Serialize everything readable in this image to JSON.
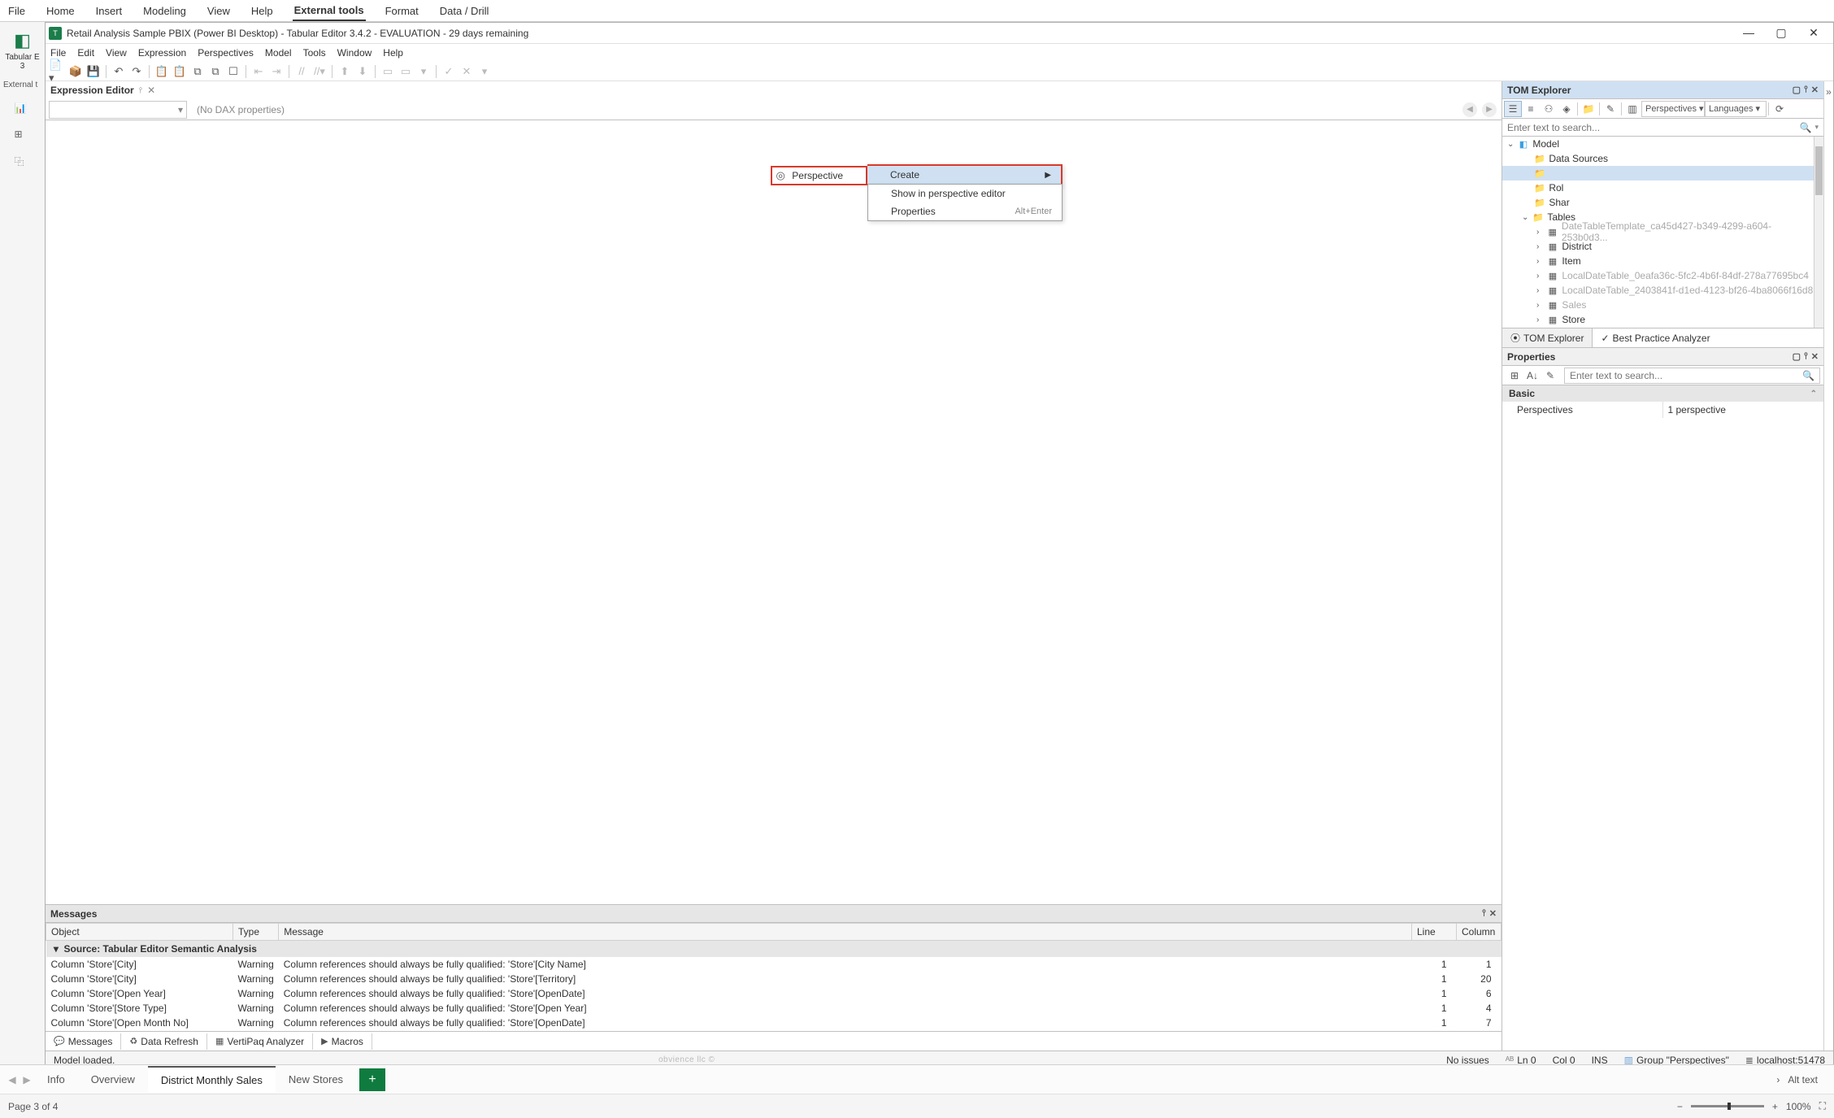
{
  "pbi_ribbon": {
    "tabs": [
      "File",
      "Home",
      "Insert",
      "Modeling",
      "View",
      "Help",
      "External tools",
      "Format",
      "Data / Drill"
    ]
  },
  "left_rail": {
    "button_line1": "Tabular E",
    "button_line2": "3",
    "section_label": "External t"
  },
  "te_window": {
    "title": "Retail Analysis Sample PBIX (Power BI Desktop) - Tabular Editor 3.4.2 - EVALUATION - 29 days remaining",
    "menu": [
      "File",
      "Edit",
      "View",
      "Expression",
      "Perspectives",
      "Model",
      "Tools",
      "Window",
      "Help"
    ]
  },
  "expression_editor": {
    "tab_label": "Expression Editor",
    "status": "(No DAX properties)"
  },
  "messages_panel": {
    "title": "Messages",
    "columns": [
      "Object",
      "Type",
      "Message",
      "Line",
      "Column"
    ],
    "source_row": "Source: Tabular Editor Semantic Analysis",
    "rows": [
      {
        "object": "Column 'Store'[City]",
        "type": "Warning",
        "message": "Column references should always be fully qualified: 'Store'[City Name]",
        "line": "1",
        "col": "1"
      },
      {
        "object": "Column 'Store'[City]",
        "type": "Warning",
        "message": "Column references should always be fully qualified: 'Store'[Territory]",
        "line": "1",
        "col": "20"
      },
      {
        "object": "Column 'Store'[Open Year]",
        "type": "Warning",
        "message": "Column references should always be fully qualified: 'Store'[OpenDate]",
        "line": "1",
        "col": "6"
      },
      {
        "object": "Column 'Store'[Store Type]",
        "type": "Warning",
        "message": "Column references should always be fully qualified: 'Store'[Open Year]",
        "line": "1",
        "col": "4"
      },
      {
        "object": "Column 'Store'[Open Month No]",
        "type": "Warning",
        "message": "Column references should always be fully qualified: 'Store'[OpenDate]",
        "line": "1",
        "col": "7"
      }
    ],
    "tabs": [
      "Messages",
      "Data Refresh",
      "VertiPaq Analyzer",
      "Macros"
    ]
  },
  "te_status_bar": {
    "left": "Model loaded.",
    "no_issues": "No issues",
    "ln": "Ln 0",
    "col": "Col 0",
    "ins": "INS",
    "group": "Group \"Perspectives\"",
    "host": "localhost:51478"
  },
  "tom_explorer": {
    "title": "TOM Explorer",
    "persp_dd": "Perspectives",
    "lang_dd": "Languages",
    "search_ph": "Enter text to search...",
    "nodes": {
      "model": "Model",
      "data_sources": "Data Sources",
      "rol": "Rol",
      "shar": "Shar",
      "tables": "Tables",
      "tbl1": "DateTableTemplate_ca45d427-b349-4299-a604-253b0d3...",
      "tbl2": "District",
      "tbl3": "Item",
      "tbl4": "LocalDateTable_0eafa36c-5fc2-4b6f-84df-278a77695bc4",
      "tbl5": "LocalDateTable_2403841f-d1ed-4123-bf26-4ba8066f16d8",
      "tbl6": "Sales",
      "tbl7": "Store"
    },
    "bottom_tabs": [
      "TOM Explorer",
      "Best Practice Analyzer"
    ]
  },
  "ctx_menu": {
    "perspective_label": "Perspective",
    "create": "Create",
    "show": "Show in perspective editor",
    "properties": "Properties",
    "properties_shortcut": "Alt+Enter"
  },
  "properties_panel": {
    "title": "Properties",
    "search_ph": "Enter text to search...",
    "cat": "Basic",
    "row_key": "Perspectives",
    "row_val": "1 perspective"
  },
  "pbi_tabs": {
    "tabs": [
      "Info",
      "Overview",
      "District Monthly Sales",
      "New Stores"
    ],
    "alt_text": "Alt text"
  },
  "pbi_footer": {
    "page": "Page 3 of 4",
    "zoom": "100%"
  },
  "trademark": "obvience llc ©"
}
